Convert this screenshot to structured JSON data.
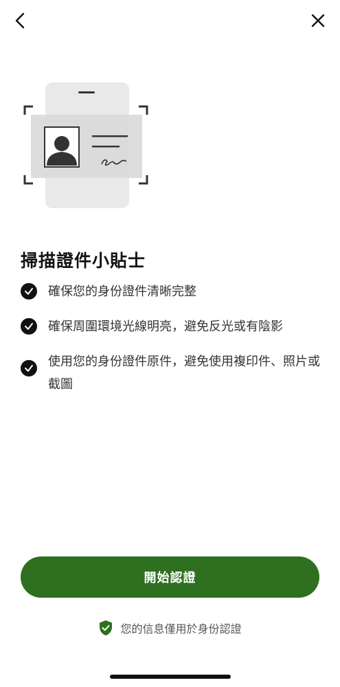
{
  "title": "掃描證件小貼士",
  "tips": [
    "確保您的身份證件清晰完整",
    "確保周圍環境光線明亮，避免反光或有陰影",
    "使用您的身份證件原件，避免使用複印件、照片或截圖"
  ],
  "cta_label": "開始認證",
  "privacy_note": "您的信息僅用於身份認證",
  "colors": {
    "accent": "#2f6f20",
    "text": "#333333"
  },
  "icons": {
    "back": "chevron-left-icon",
    "close": "close-icon",
    "check": "check-circle-icon",
    "shield": "shield-check-icon"
  }
}
